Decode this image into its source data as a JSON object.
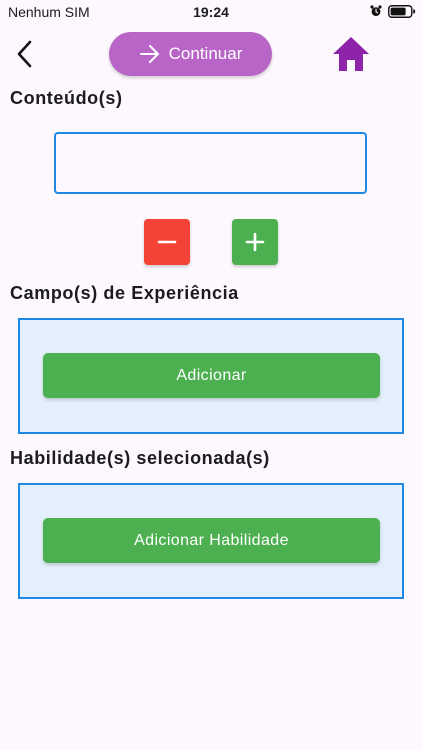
{
  "status_bar": {
    "carrier": "Nenhum SIM",
    "time": "19:24",
    "icons": [
      "alarm-icon",
      "battery-icon"
    ]
  },
  "app_bar": {
    "back_icon": "chevron-left-icon",
    "continue_label": "Continuar",
    "continue_icon": "arrow-right-icon",
    "home_icon": "home-icon"
  },
  "content": {
    "title": "Conteúdo(s)",
    "input_value": "",
    "input_placeholder": "",
    "remove_icon": "minus-icon",
    "add_icon": "plus-icon"
  },
  "experience": {
    "title": "Campo(s) de Experiência",
    "add_label": "Adicionar"
  },
  "skills": {
    "title": "Habilidade(s) selecionada(s)",
    "add_label": "Adicionar Habilidade"
  },
  "colors": {
    "primary_purple": "#b965c8",
    "home_purple": "#8e24aa",
    "accent_blue": "#1e88e5",
    "panel_bg": "#e3f0fb",
    "green": "#4caf50",
    "red": "#f44336"
  }
}
